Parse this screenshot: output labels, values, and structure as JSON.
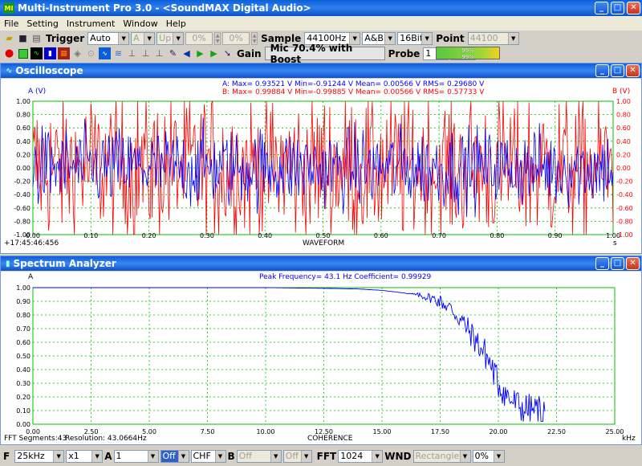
{
  "window": {
    "title": "Multi-Instrument Pro 3.0 - <SoundMAX Digital Audio>",
    "app_icon": "MI"
  },
  "menu": [
    "File",
    "Setting",
    "Instrument",
    "Window",
    "Help"
  ],
  "toolbar1": {
    "trigger_label": "Trigger",
    "trigger_mode": "Auto",
    "channel": "A",
    "edge": "Up",
    "level1": "0%",
    "level2": "0%",
    "sample_label": "Sample",
    "sample_rate": "44100Hz",
    "channels": "A&B",
    "bits": "16Bit",
    "point_label": "Point",
    "points": "44100"
  },
  "toolbar2": {
    "gain_label": "Gain",
    "mic": "Mic 70.4% with Boost",
    "probe_label": "Probe",
    "probe_a": "1",
    "probe_b": "1",
    "level_a": "99%",
    "level_b": "99%"
  },
  "oscilloscope": {
    "title": "Oscilloscope",
    "left_axis": "A (V)",
    "right_axis": "B (V)",
    "stats_a": "A: Max= 0.93521 V  Min=-0.91244 V  Mean= 0.00566 V  RMS= 0.29680 V",
    "stats_b": "B: Max= 0.99884 V  Min=-0.99885 V  Mean= 0.00566 V  RMS= 0.57733 V",
    "xlabel": "WAVEFORM",
    "x_unit": "s",
    "timestamp": "+17:45:46:456",
    "yticks": [
      "1.00",
      "0.80",
      "0.60",
      "0.40",
      "0.20",
      "0.00",
      "-0.20",
      "-0.40",
      "-0.60",
      "-0.80",
      "-1.00"
    ],
    "xticks": [
      "0.00",
      "0.10",
      "0.20",
      "0.30",
      "0.40",
      "0.50",
      "0.60",
      "0.70",
      "0.80",
      "0.90",
      "1.00"
    ]
  },
  "spectrum": {
    "title": "Spectrum Analyzer",
    "left_axis": "A",
    "peak_info": "Peak Frequency= 43.1 Hz   Coefficient= 0.99929",
    "xlabel": "COHERENCE",
    "x_unit": "kHz",
    "fft_segments": "FFT Segments:43",
    "resolution": "Resolution: 43.0664Hz",
    "yticks": [
      "1.00",
      "0.90",
      "0.80",
      "0.70",
      "0.60",
      "0.50",
      "0.40",
      "0.30",
      "0.20",
      "0.10",
      "0.00"
    ],
    "xticks": [
      "0.00",
      "2.50",
      "5.00",
      "7.50",
      "10.00",
      "12.50",
      "15.00",
      "17.50",
      "20.00",
      "22.50",
      "25.00"
    ]
  },
  "statusbar": {
    "f_label": "F",
    "freq_range": "25kHz",
    "zoom": "x1",
    "a_label": "A",
    "a_val": "1",
    "off1": "Off",
    "chf": "CHF",
    "b_label": "B",
    "b_val": "Off",
    "off2": "Off",
    "fft_label": "FFT",
    "fft_size": "1024",
    "wnd_label": "WND",
    "window_fn": "Rectangle",
    "overlap": "0%"
  },
  "chart_data": [
    {
      "type": "line",
      "title": "WAVEFORM",
      "xlabel": "s",
      "ylabel": "A (V)",
      "xlim": [
        0,
        1
      ],
      "ylim": [
        -1,
        1
      ],
      "grid": true,
      "series": [
        {
          "name": "A",
          "max": 0.93521,
          "min": -0.91244,
          "mean": 0.00566,
          "rms": 0.2968,
          "color": "#0000ff"
        },
        {
          "name": "B",
          "max": 0.99884,
          "min": -0.99885,
          "mean": 0.00566,
          "rms": 0.57733,
          "color": "#ff0000"
        }
      ]
    },
    {
      "type": "line",
      "title": "COHERENCE",
      "xlabel": "kHz",
      "ylabel": "A",
      "xlim": [
        0,
        25
      ],
      "ylim": [
        0,
        1
      ],
      "grid": true,
      "x": [
        0,
        2.5,
        5,
        7.5,
        10,
        12.5,
        14,
        15,
        16,
        17,
        17.5,
        18,
        18.5,
        19,
        19.5,
        20,
        20.5,
        21,
        21.5,
        22
      ],
      "series": [
        {
          "name": "A",
          "color": "#0000ff",
          "values": [
            1,
            1,
            1,
            1,
            1,
            0.995,
            0.99,
            0.98,
            0.96,
            0.93,
            0.9,
            0.84,
            0.74,
            0.62,
            0.5,
            0.3,
            0.18,
            0.12,
            0.1,
            0.1
          ]
        }
      ]
    }
  ]
}
